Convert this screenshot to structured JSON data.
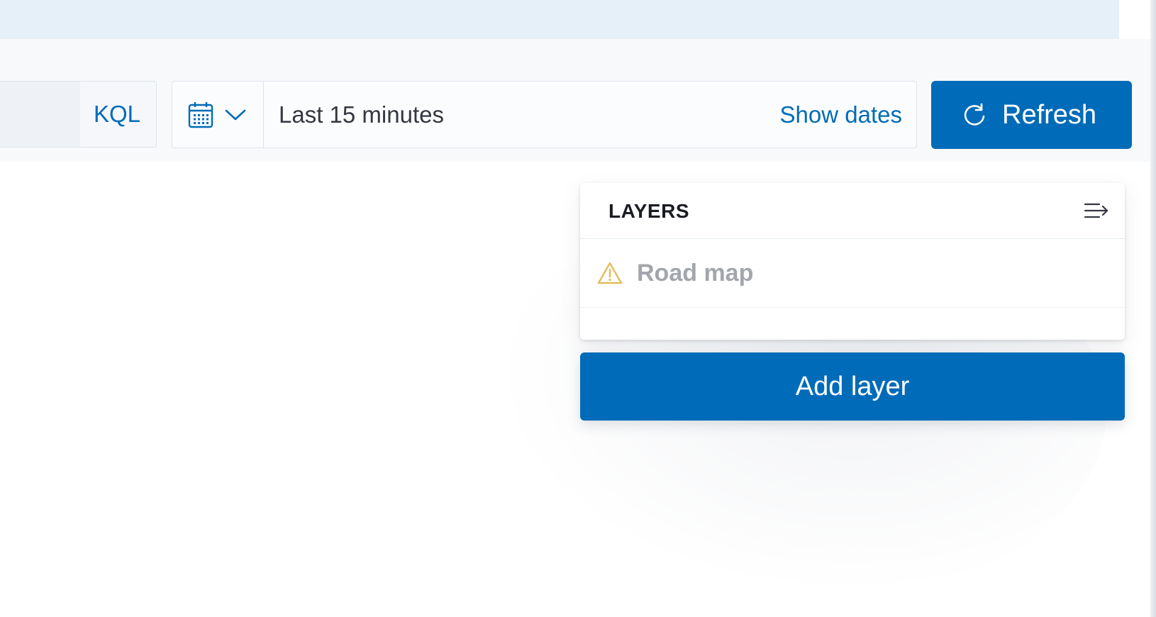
{
  "query_bar": {
    "language_label": "KQL"
  },
  "date_picker": {
    "range_text": "Last 15 minutes",
    "show_dates_label": "Show dates"
  },
  "refresh": {
    "label": "Refresh"
  },
  "layers_panel": {
    "title": "LAYERS",
    "layers": [
      {
        "name": "Road map",
        "status_icon": "warning-icon"
      }
    ]
  },
  "add_layer": {
    "label": "Add layer"
  },
  "colors": {
    "primary": "#006bb8",
    "warning": "#e2bd5b",
    "muted_text": "#a2a6ac",
    "callout_bg": "#e6f0f8"
  }
}
